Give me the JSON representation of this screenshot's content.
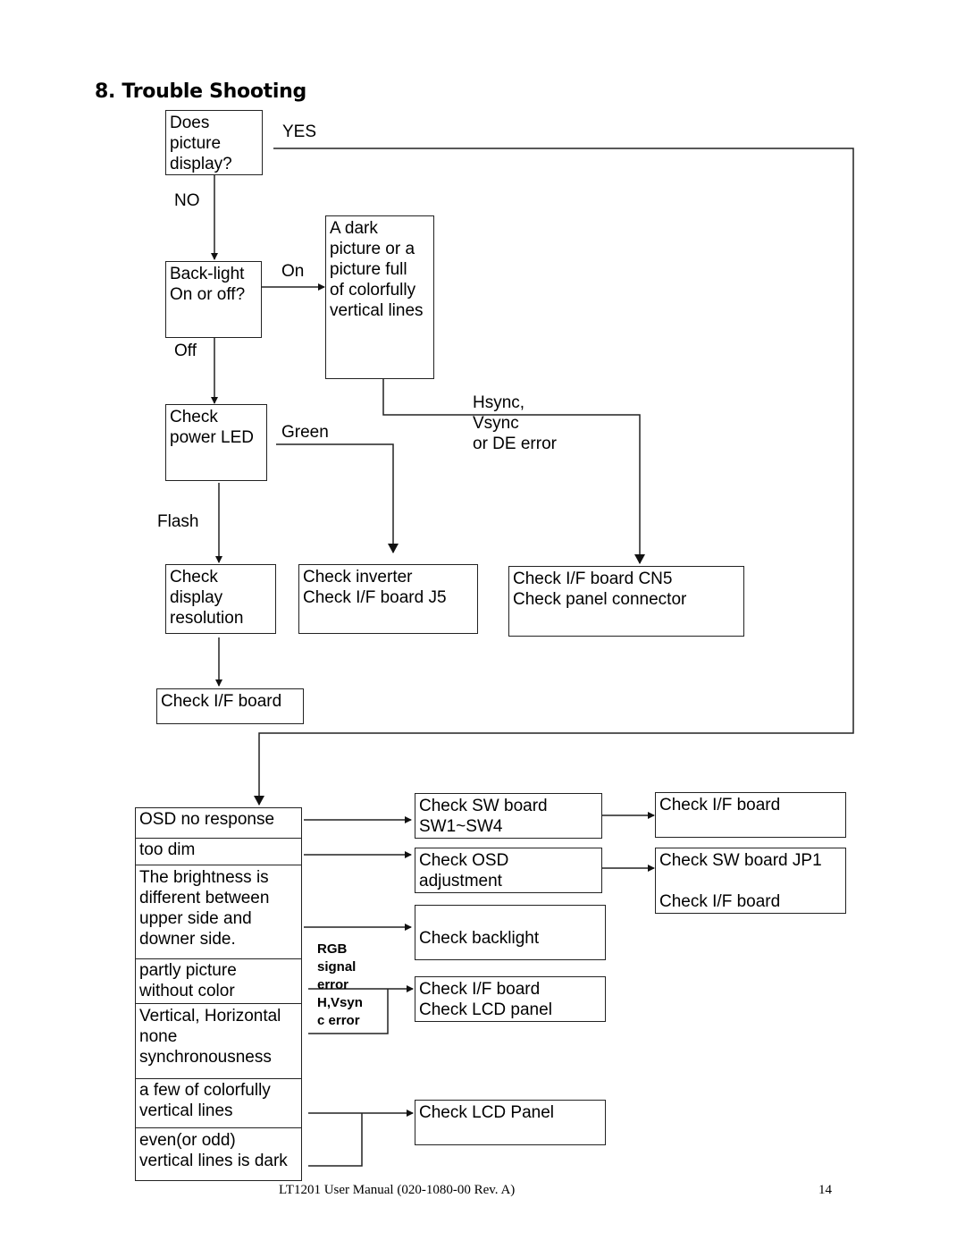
{
  "page": {
    "section_title": "8. Trouble Shooting",
    "footer": {
      "manual": "LT1201 User Manual (020-1080-00 Rev. A)",
      "page_number": "14"
    }
  },
  "flowchart": {
    "nodes": {
      "picture_display": "Does\npicture\ndisplay?",
      "backlight": "Back-light\n  On or off?",
      "dark_picture": "A dark\npicture or a\npicture full\nof colorfully\nvertical lines",
      "power_led": "Check\npower LED",
      "display_resolution": "Check\ndisplay\nresolution",
      "inverter": "Check inverter\nCheck I/F board J5",
      "if_board_cn5": "Check I/F board CN5\nCheck panel connector",
      "if_board_1": "Check I/F board",
      "sw_board": "Check SW board\nSW1~SW4",
      "if_board_2": "Check I/F board",
      "osd_adjustment": "Check OSD\nadjustment",
      "sw_board_jp1": "Check SW board JP1\n\nCheck I/F board",
      "backlight_check": "\nCheck backlight",
      "if_lcd": "Check I/F board\nCheck LCD panel",
      "lcd_panel": "Check LCD Panel"
    },
    "edge_labels": {
      "yes": "YES",
      "no": "NO",
      "on": "On",
      "off": "Off",
      "green": "Green",
      "flash": "Flash",
      "sync_error": "Hsync,\nVsync\nor DE error",
      "rgb_error": "RGB\nsignal\nerror",
      "hv_error": "H,Vsyn\nc error"
    },
    "symptoms": [
      "OSD no response",
      "too dim",
      "The brightness is\ndifferent between\nupper side and\ndowner side.",
      "partly picture\nwithout color",
      "Vertical, Horizontal\nnone\nsynchronousness",
      "a few of colorfully\nvertical lines",
      "even(or odd)\nvertical lines is dark"
    ]
  }
}
